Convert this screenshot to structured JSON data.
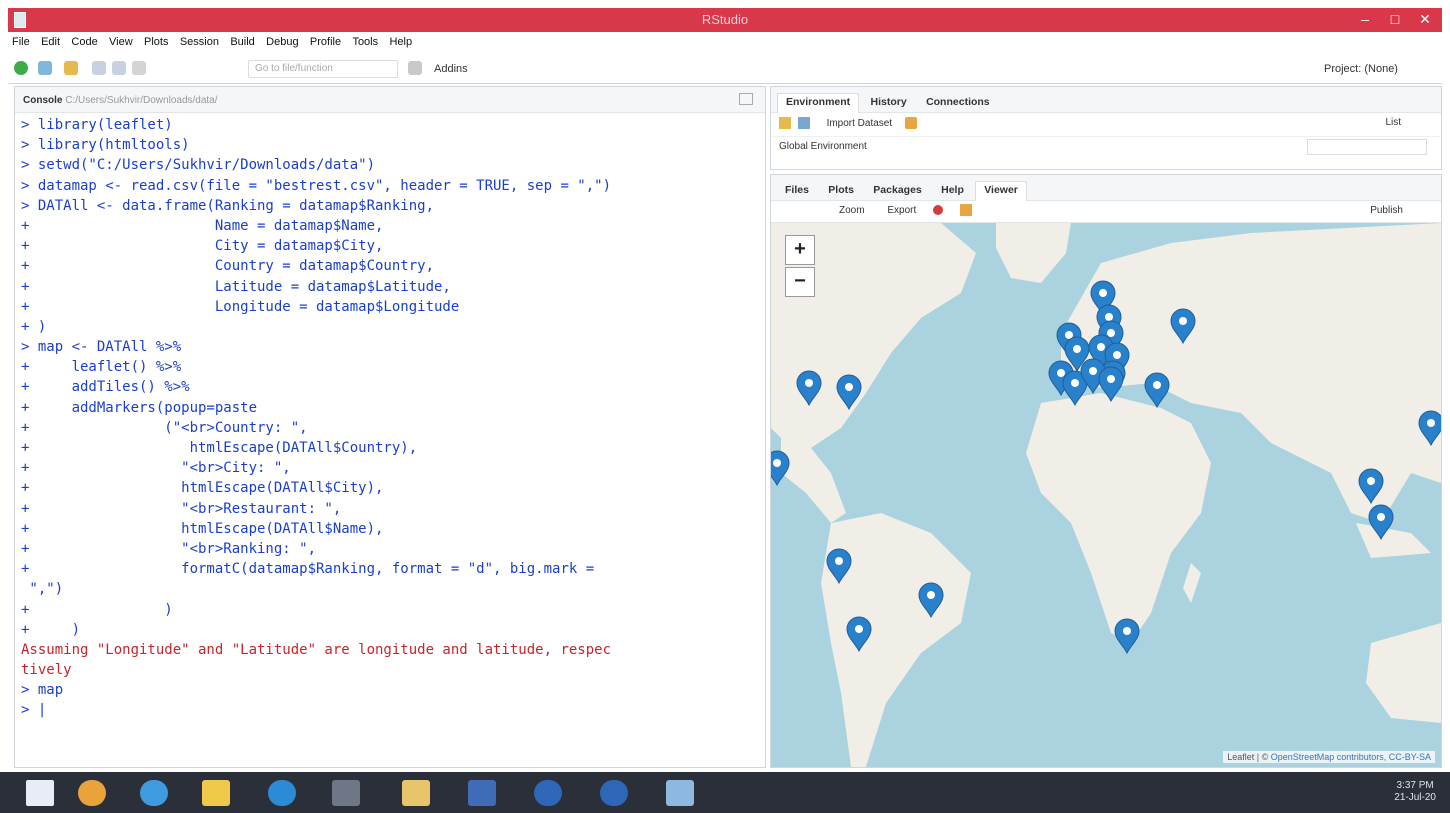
{
  "window": {
    "title": "RStudio",
    "minimize": "–",
    "maximize": "□",
    "close": "✕"
  },
  "menu": [
    "File",
    "Edit",
    "Code",
    "View",
    "Plots",
    "Session",
    "Build",
    "Debug",
    "Profile",
    "Tools",
    "Help"
  ],
  "toolbar": {
    "goto_placeholder": "Go to file/function",
    "addins": "Addins",
    "project": "Project: (None)"
  },
  "console": {
    "tab": "Console",
    "path": "C:/Users/Sukhvir/Downloads/data/",
    "lines": [
      {
        "t": "> library(leaflet)",
        "err": false
      },
      {
        "t": "> library(htmltools)",
        "err": false
      },
      {
        "t": "> setwd(\"C:/Users/Sukhvir/Downloads/data\")",
        "err": false
      },
      {
        "t": "> datamap <- read.csv(file = \"bestrest.csv\", header = TRUE, sep = \",\")",
        "err": false
      },
      {
        "t": "> DATAll <- data.frame(Ranking = datamap$Ranking,",
        "err": false
      },
      {
        "t": "+                      Name = datamap$Name,",
        "err": false
      },
      {
        "t": "+                      City = datamap$City,",
        "err": false
      },
      {
        "t": "+                      Country = datamap$Country,",
        "err": false
      },
      {
        "t": "+                      Latitude = datamap$Latitude,",
        "err": false
      },
      {
        "t": "+                      Longitude = datamap$Longitude",
        "err": false
      },
      {
        "t": "+ )",
        "err": false
      },
      {
        "t": "> map <- DATAll %>%",
        "err": false
      },
      {
        "t": "+     leaflet() %>%",
        "err": false
      },
      {
        "t": "+     addTiles() %>%",
        "err": false
      },
      {
        "t": "+     addMarkers(popup=paste",
        "err": false
      },
      {
        "t": "+                (\"<br>Country: \",",
        "err": false
      },
      {
        "t": "+                   htmlEscape(DATAll$Country),",
        "err": false
      },
      {
        "t": "+                  \"<br>City: \",",
        "err": false
      },
      {
        "t": "+                  htmlEscape(DATAll$City),",
        "err": false
      },
      {
        "t": "+                  \"<br>Restaurant: \",",
        "err": false
      },
      {
        "t": "+                  htmlEscape(DATAll$Name),",
        "err": false
      },
      {
        "t": "+                  \"<br>Ranking: \",",
        "err": false
      },
      {
        "t": "+                  formatC(datamap$Ranking, format = \"d\", big.mark =",
        "err": false
      },
      {
        "t": " \",\")",
        "err": false
      },
      {
        "t": "+                )",
        "err": false
      },
      {
        "t": "+     )",
        "err": false
      },
      {
        "t": "Assuming \"Longitude\" and \"Latitude\" are longitude and latitude, respec",
        "err": true
      },
      {
        "t": "tively",
        "err": true
      },
      {
        "t": "> map",
        "err": false
      },
      {
        "t": "> |",
        "err": false
      }
    ]
  },
  "env_pane": {
    "tabs": [
      "Environment",
      "History",
      "Connections"
    ],
    "import": "Import Dataset",
    "list": "List",
    "scope": "Global Environment"
  },
  "viewer_pane": {
    "tabs": [
      "Files",
      "Plots",
      "Packages",
      "Help",
      "Viewer"
    ],
    "zoom": "Zoom",
    "export": "Export",
    "publish": "Publish"
  },
  "map": {
    "zoom_in": "+",
    "zoom_out": "−",
    "attribution_prefix": "Leaflet | © ",
    "attribution_link": "OpenStreetMap contributors, CC-BY-SA",
    "colors": {
      "ocean": "#aad3df",
      "land": "#f1eee8",
      "marker": "#2a81cb"
    },
    "markers_count": 24
  },
  "taskbar": {
    "time": "3:37 PM",
    "date": "21-Jul-20"
  }
}
